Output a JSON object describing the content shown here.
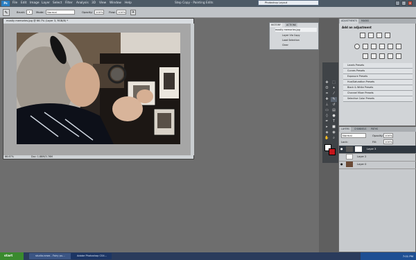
{
  "app": {
    "logo_text": "Ps",
    "window_title": "Step Copy - Painting Edits"
  },
  "menu": [
    "File",
    "Edit",
    "Image",
    "Layer",
    "Select",
    "Filter",
    "Analysis",
    "3D",
    "View",
    "Window",
    "Help"
  ],
  "floating_window": {
    "title": "Photoshop Layout"
  },
  "options_bar": {
    "brush_label": "Brush:",
    "mode_label": "Mode:",
    "mode_value": "Normal",
    "opacity_label": "Opacity:",
    "opacity_value": "100%",
    "flow_label": "Flow:",
    "flow_value": "100%"
  },
  "document": {
    "title": "mostly memories.jpg @ 66.7% (Layer 3, RGB/8) *",
    "zoom": "66.67%",
    "doc_size": "Doc: 1.88M/3.76M"
  },
  "history": {
    "tabs": [
      "HISTORY",
      "ACTIONS"
    ],
    "items": [
      "mostly memories.jpg",
      "Layer Via Copy",
      "Load Selection",
      "Clear"
    ]
  },
  "adjustments": {
    "tabs": [
      "ADJUSTMENTS",
      "MASKS"
    ],
    "heading": "Add an adjustment",
    "presets": [
      "Levels Presets",
      "Curves Presets",
      "Exposure Presets",
      "Hue/Saturation Presets",
      "Black & White Presets",
      "Channel Mixer Presets",
      "Selective Color Presets"
    ]
  },
  "layers": {
    "tabs": [
      "LAYERS",
      "CHANNELS",
      "PATHS"
    ],
    "blend_mode": "Normal",
    "opacity_label": "Opacity:",
    "opacity_value": "100%",
    "lock_label": "Lock:",
    "fill_label": "Fill:",
    "fill_value": "100%",
    "items": [
      "Layer 3",
      "Layer 2",
      "Layer 0"
    ]
  },
  "taskbar": {
    "start": "start",
    "buttons": [
      "studio.news - Fairy pu...",
      "Adobe Photoshop CS4..."
    ],
    "clock": "7:01 PM"
  }
}
